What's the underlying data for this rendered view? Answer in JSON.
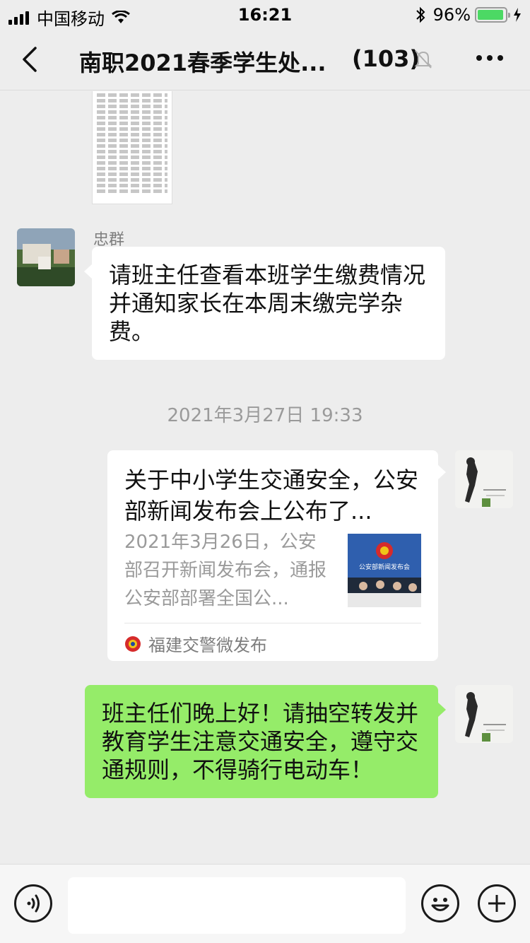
{
  "status_bar": {
    "carrier": "中国移动",
    "time": "16:21",
    "battery_percent": "96%",
    "battery_level": 0.96
  },
  "nav": {
    "title": "南职2021春季学生处...",
    "member_count": "(103)"
  },
  "messages": {
    "sender_name": "忠群",
    "msg1": "请班主任查看本班学生缴费情况并通知家长在本周末缴完学杂费。",
    "timestamp": "2021年3月27日 19:33",
    "link": {
      "title": "关于中小学生交通安全，公安部新闻发布会上公布了...",
      "description": "2021年3月26日，公安部召开新闻发布会，通报公安部部署全国公...",
      "thumb_text": "公安部新闻发布会",
      "source": "福建交警微发布"
    },
    "msg3": "班主任们晚上好！请抽空转发并教育学生注意交通安全，遵守交通规则，不得骑行电动车！"
  },
  "colors": {
    "background": "#ededed",
    "bubble_self": "#95ec69",
    "bubble_other": "#ffffff",
    "battery_fill": "#4cd964"
  }
}
